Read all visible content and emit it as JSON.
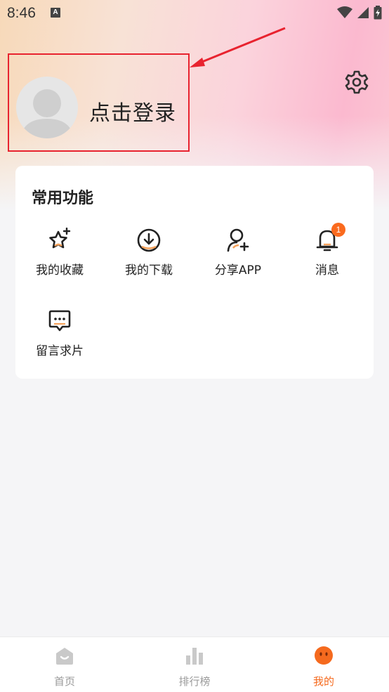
{
  "status_bar": {
    "time": "8:46",
    "notification_icon": "A"
  },
  "profile": {
    "login_prompt": "点击登录"
  },
  "common_functions": {
    "title": "常用功能",
    "items": [
      {
        "label": "我的收藏",
        "icon": "star-icon"
      },
      {
        "label": "我的下载",
        "icon": "download-icon"
      },
      {
        "label": "分享APP",
        "icon": "share-user-icon"
      },
      {
        "label": "消息",
        "icon": "bell-icon",
        "badge": "1"
      },
      {
        "label": "留言求片",
        "icon": "chat-icon"
      }
    ]
  },
  "tabbar": {
    "tabs": [
      {
        "label": "首页",
        "icon": "home-icon",
        "active": false
      },
      {
        "label": "排行榜",
        "icon": "ranking-icon",
        "active": false
      },
      {
        "label": "我的",
        "icon": "profile-icon",
        "active": true
      }
    ]
  },
  "colors": {
    "accent": "#f56a1e",
    "highlight_box": "#e8232f",
    "badge": "#fa6a1e"
  }
}
